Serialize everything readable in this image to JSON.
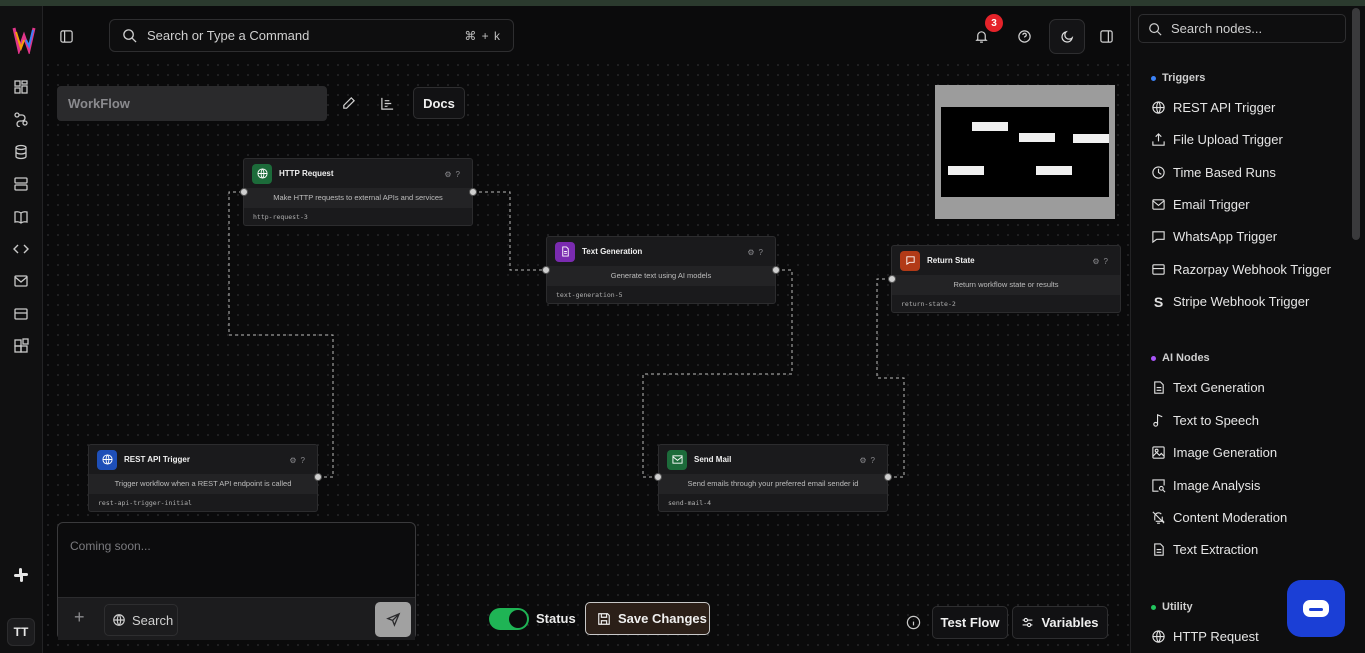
{
  "header": {
    "search_placeholder": "Search or Type a Command",
    "search_shortcut": "⌘ + k",
    "notification_count": "3"
  },
  "toolbar": {
    "workflow_name": "WorkFlow",
    "docs_label": "Docs"
  },
  "nodes": [
    {
      "title": "HTTP Request",
      "description": "Make HTTP requests to external APIs and services",
      "id": "http-request-3",
      "color": "#1c6b3a",
      "icon": "globe-icon"
    },
    {
      "title": "Text Generation",
      "description": "Generate text using AI models",
      "id": "text-generation-5",
      "color": "#7a2bb0",
      "icon": "document-icon"
    },
    {
      "title": "Return State",
      "description": "Return workflow state or results",
      "id": "return-state-2",
      "color": "#b23a17",
      "icon": "message-icon"
    },
    {
      "title": "REST API Trigger",
      "description": "Trigger workflow when a REST API endpoint is called",
      "id": "rest-api-trigger-initial",
      "color": "#1e4fb8",
      "icon": "globe-icon"
    },
    {
      "title": "Send Mail",
      "description": "Send emails through your preferred email sender id",
      "id": "send-mail-4",
      "color": "#1c6b3a",
      "icon": "mail-icon"
    }
  ],
  "chat": {
    "placeholder": "Coming soon...",
    "search_label": "Search"
  },
  "controls": {
    "status_label": "Status",
    "status_on": true,
    "save_label": "Save Changes",
    "test_flow_label": "Test Flow",
    "variables_label": "Variables"
  },
  "panel": {
    "search_placeholder": "Search nodes...",
    "sections": [
      {
        "title": "Triggers",
        "color": "#3b82f6",
        "items": [
          "REST API Trigger",
          "File Upload Trigger",
          "Time Based Runs",
          "Email Trigger",
          "WhatsApp Trigger",
          "Razorpay Webhook Trigger",
          "Stripe Webhook Trigger"
        ]
      },
      {
        "title": "AI Nodes",
        "color": "#a855f7",
        "items": [
          "Text Generation",
          "Text to Speech",
          "Image Generation",
          "Image Analysis",
          "Content Moderation",
          "Text Extraction"
        ]
      },
      {
        "title": "Utility",
        "color": "#22c55e",
        "items": [
          "HTTP Request"
        ]
      }
    ]
  },
  "user": {
    "initials": "TT"
  }
}
